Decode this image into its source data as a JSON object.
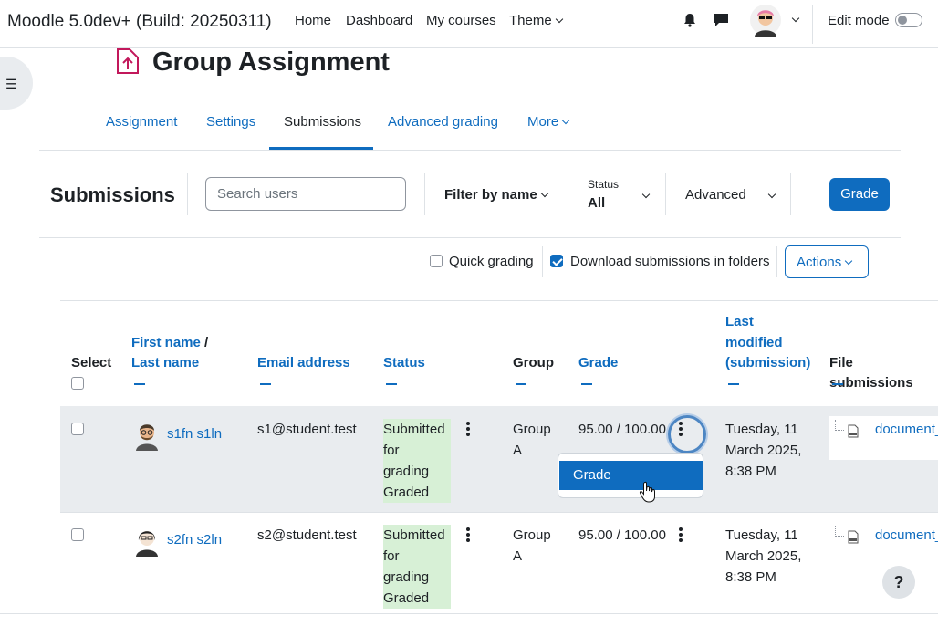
{
  "navbar": {
    "site_title": "Moodle 5.0dev+ (Build: 20250311)",
    "links": [
      "Home",
      "Dashboard",
      "My courses",
      "Theme"
    ],
    "edit_mode_label": "Edit mode"
  },
  "drawer": {
    "icon": "list-icon"
  },
  "page": {
    "title": "Group Assignment"
  },
  "tabs": [
    {
      "label": "Assignment"
    },
    {
      "label": "Settings"
    },
    {
      "label": "Submissions"
    },
    {
      "label": "Advanced grading"
    },
    {
      "label": "More"
    }
  ],
  "tertiary": {
    "heading": "Submissions",
    "search_placeholder": "Search users",
    "filter_by_name": "Filter by name",
    "status_label": "Status",
    "status_value": "All",
    "advanced": "Advanced",
    "grade_button": "Grade"
  },
  "options": {
    "quick_grading": "Quick grading",
    "download_folders": "Download submissions in folders",
    "actions": "Actions"
  },
  "table": {
    "headers": {
      "select": "Select",
      "first_name": "First name",
      "slash": "/",
      "last_name": "Last name",
      "email": "Email address",
      "status": "Status",
      "group": "Group",
      "grade": "Grade",
      "last_modified_1": "Last",
      "last_modified_2": "modified",
      "last_modified_3": "(submission)",
      "file_submissions": "File submissions"
    },
    "rows": [
      {
        "name": "s1fn s1ln",
        "email": "s1@student.test",
        "status": [
          "Submitted",
          "for",
          "grading",
          "Graded"
        ],
        "group": [
          "Group",
          "A"
        ],
        "grade": "95.00 / 100.00",
        "modified": [
          "Tuesday, 11",
          "March 2025,",
          "8:38 PM"
        ],
        "file": "document_"
      },
      {
        "name": "s2fn s2ln",
        "email": "s2@student.test",
        "status": [
          "Submitted",
          "for",
          "grading",
          "Graded"
        ],
        "group": [
          "Group",
          "A"
        ],
        "grade": "95.00 / 100.00",
        "modified": [
          "Tuesday, 11",
          "March 2025,",
          "8:38 PM"
        ],
        "file": "document_"
      }
    ]
  },
  "dropdown": {
    "item": "Grade"
  },
  "help": {
    "label": "?"
  },
  "colors": {
    "primary": "#0f6cbf",
    "badge_success": "#d7f0d6",
    "row_highlight": "#e9ecef"
  }
}
